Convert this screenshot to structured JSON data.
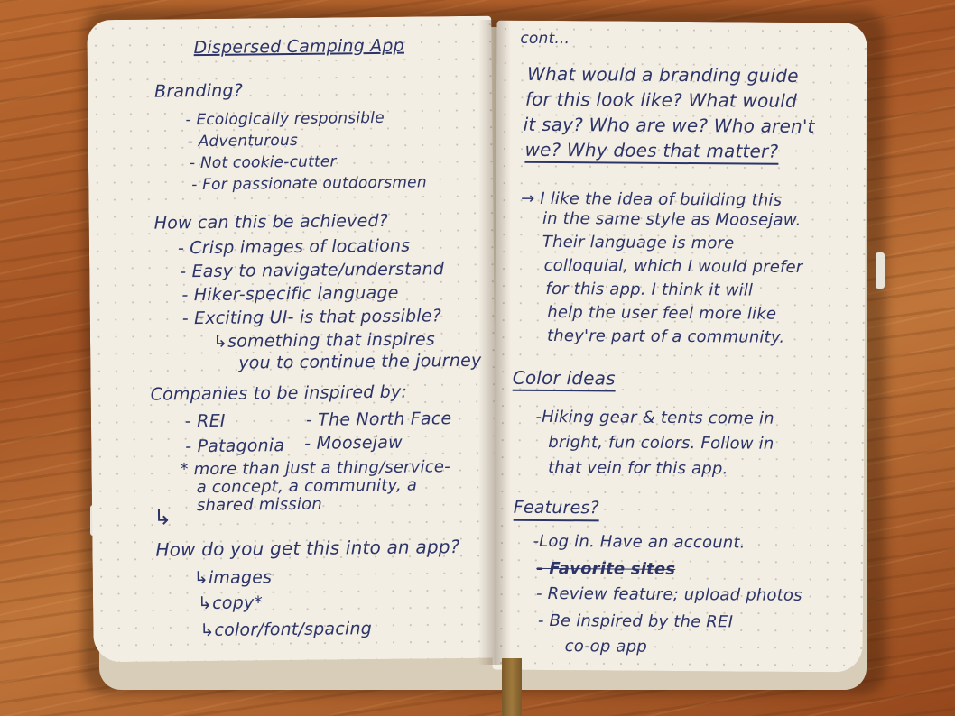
{
  "left_page": {
    "title": "Dispersed Camping App",
    "branding": {
      "heading": "Branding?",
      "items": [
        "- Ecologically responsible",
        "- Adventurous",
        "- Not cookie-cutter",
        "- For passionate outdoorsmen"
      ]
    },
    "achieve": {
      "heading": "How can this be achieved?",
      "items": [
        "- Crisp images of locations",
        "- Easy to navigate/understand",
        "- Hiker-specific language",
        "- Exciting UI- is that possible?"
      ],
      "sub_lines": [
        "↳something that inspires",
        "you to continue the journey"
      ]
    },
    "companies": {
      "heading": "Companies to be inspired by:",
      "col_a": [
        "- REI",
        "- Patagonia"
      ],
      "col_b": [
        "- The North Face",
        "- Moosejaw"
      ],
      "note_lines": [
        "* more than just a thing/service-",
        "a concept, a community, a",
        "shared mission"
      ]
    },
    "app": {
      "arrow": "↳",
      "heading": "How do you get this into an app?",
      "items": [
        "↳images",
        "↳copy*",
        "↳color/font/spacing"
      ]
    }
  },
  "right_page": {
    "cont": "cont...",
    "question_lines": [
      "What would a branding guide",
      "for this look like? What would",
      "it say? Who are we? Who aren't",
      "we? Why does that matter?"
    ],
    "moosejaw_lines": [
      "→ I like the idea of building this",
      "in the same style as Moosejaw.",
      "Their language is more",
      "colloquial, which I would prefer",
      "for this app. I think it will",
      "help the user feel more like",
      "they're part of a community."
    ],
    "color": {
      "heading": "Color ideas",
      "lines": [
        "-Hiking gear & tents come in",
        "bright, fun colors. Follow in",
        "that vein for this app."
      ]
    },
    "features": {
      "heading": "Features?",
      "items": [
        "-Log in. Have an account.",
        "- Favorite sites",
        "- Review feature; upload photos",
        "- Be inspired by the REI",
        "co-op app"
      ]
    }
  }
}
